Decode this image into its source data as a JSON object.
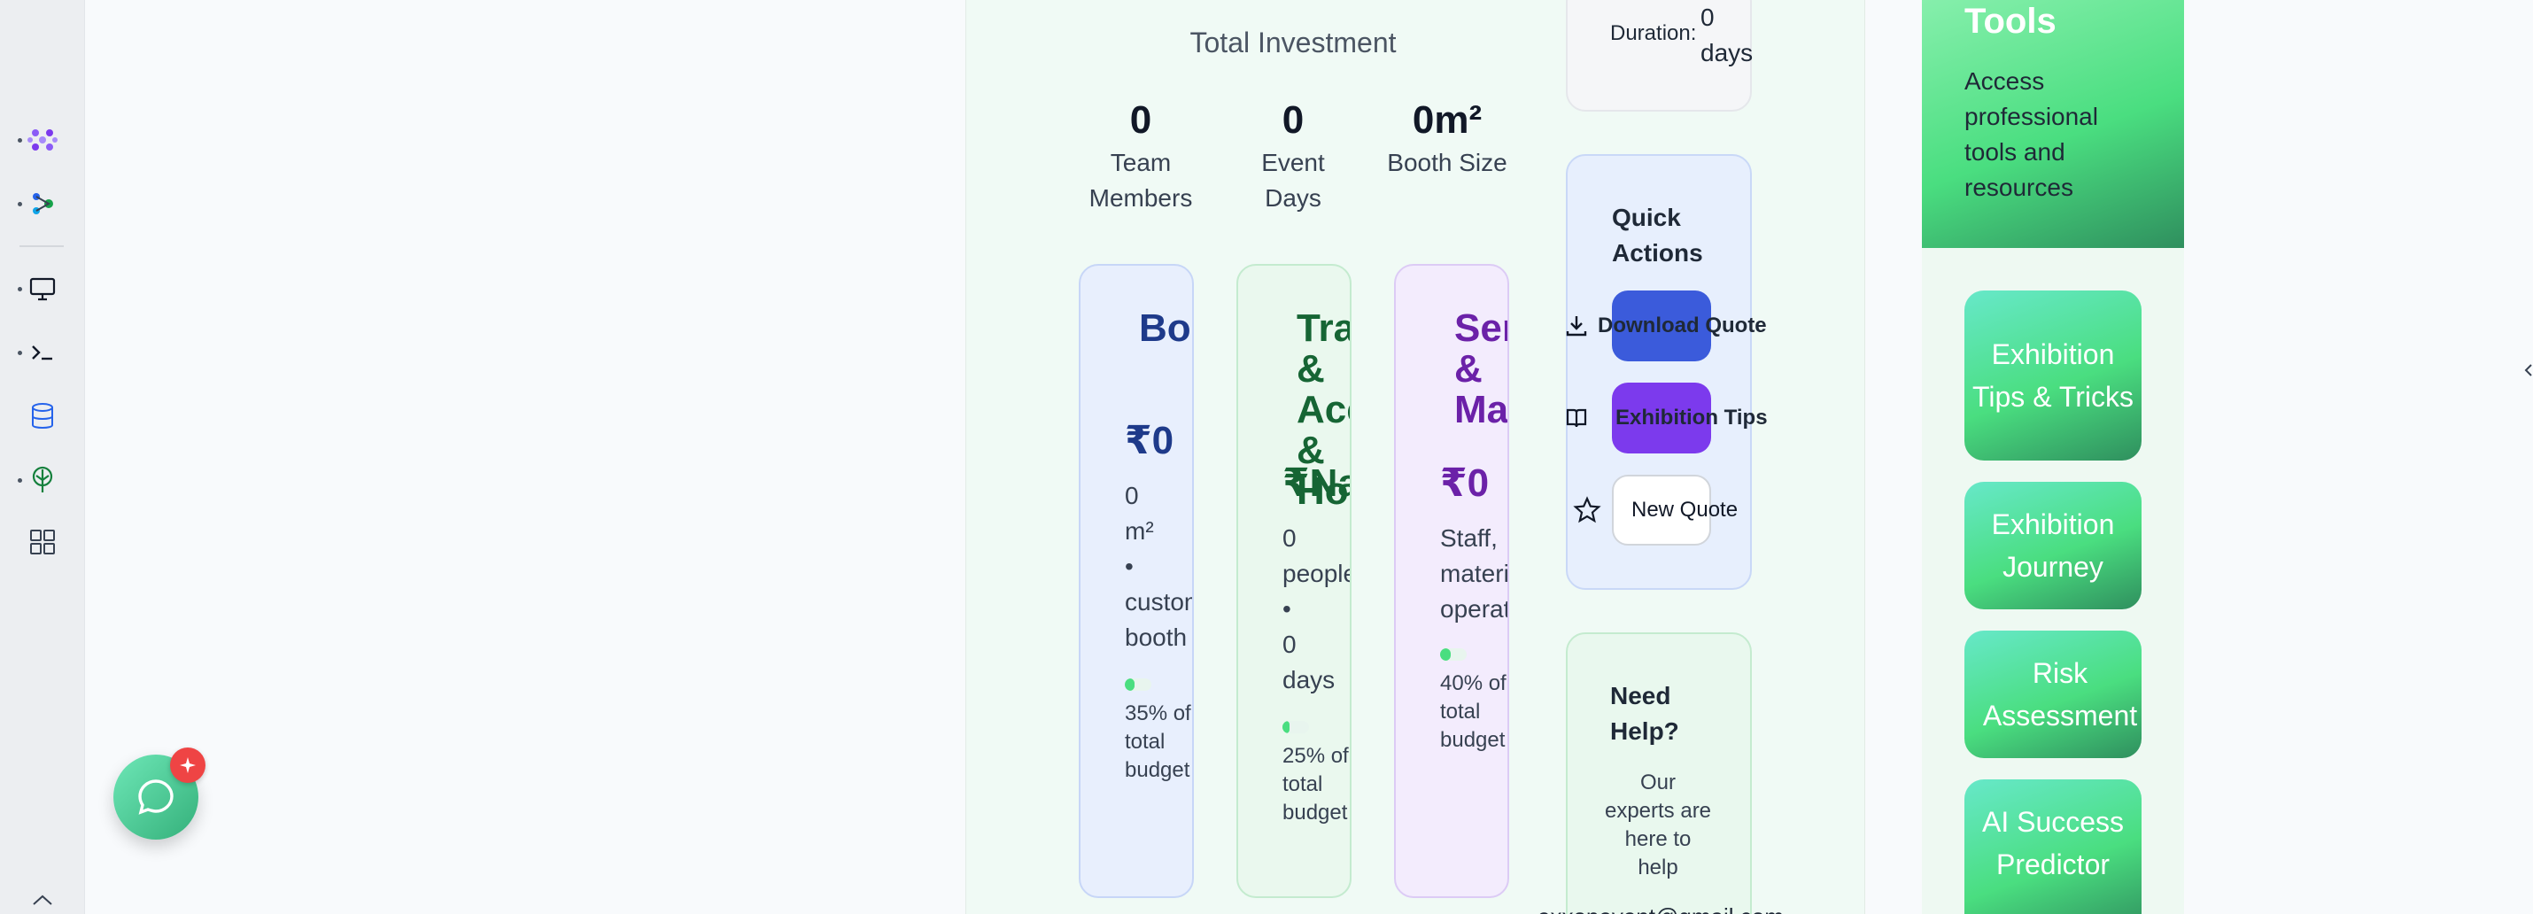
{
  "main": {
    "total_title": "Total Investment",
    "stats": [
      {
        "value": "0",
        "label": "Team Members"
      },
      {
        "value": "0",
        "label": "Event Days"
      },
      {
        "value": "0m²",
        "label": "Booth Size"
      }
    ],
    "categories": [
      {
        "title": "Booth & Construction",
        "amount": "₹0",
        "desc": [
          "0",
          "m²",
          "•",
          "custom",
          "booth"
        ],
        "pct_text": "35% of total budget",
        "pct": 0.35,
        "color": "#1e3a8a"
      },
      {
        "title": "Travel & Accommodation & Hotel",
        "amount": "₹NaN",
        "desc": [
          "0",
          "people",
          "•",
          "0",
          "days"
        ],
        "pct_text": "25% of total budget",
        "pct": 0.25,
        "color": "#166534"
      },
      {
        "title": "Services & Marketing",
        "amount": "₹0",
        "desc": [
          "Staff,",
          "materials,",
          "operations"
        ],
        "pct_text": "40% of total budget",
        "pct": 0.4,
        "color": "#6b21a8"
      }
    ]
  },
  "duration": {
    "label": "Duration:",
    "value": "0 days"
  },
  "quick_actions": {
    "title": "Quick Actions",
    "download": "Download Quote",
    "tips": "Exhibition Tips",
    "new_quote": "New Quote"
  },
  "help": {
    "title": "Need Help?",
    "text": "Our experts are here to help",
    "email": "exxonevent@gmail.com"
  },
  "tools": {
    "title": "Tools",
    "desc": "Access professional tools and resources",
    "items": [
      "Exhibition Tips & Tricks",
      "Exhibition Journey",
      "Risk Assessment",
      "AI Success Predictor"
    ]
  },
  "colors": {
    "accent_blue": "#3b5bdb",
    "accent_purple": "#7c3aed",
    "green": "#4ade80",
    "badge_red": "#ef4444"
  }
}
